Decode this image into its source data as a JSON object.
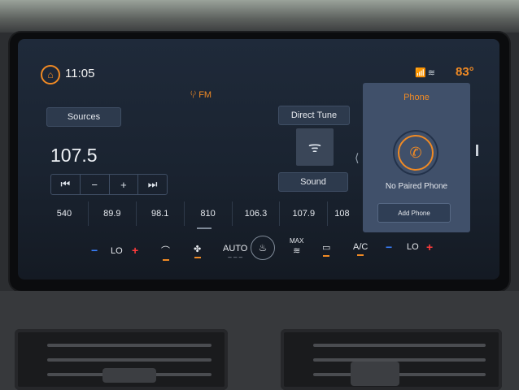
{
  "status": {
    "time": "11:05",
    "temperature": "83°",
    "icons": [
      "phone-signal-icon",
      "wifi-icon"
    ]
  },
  "radio": {
    "band_label": "FM",
    "frequency": "107.5",
    "sources_label": "Sources",
    "direct_tune_label": "Direct Tune",
    "sound_label": "Sound",
    "seek": {
      "prev": "⏮",
      "down": "−",
      "up": "+",
      "next": "⏭"
    },
    "presets": [
      "540",
      "89.9",
      "98.1",
      "810",
      "106.3",
      "107.9",
      "108"
    ]
  },
  "phone": {
    "title": "Phone",
    "status": "No Paired Phone",
    "add_label": "Add Phone"
  },
  "climate": {
    "driver_temp": "LO",
    "passenger_temp": "LO",
    "auto_label": "AUTO",
    "max_label": "MAX",
    "ac_label": "A/C"
  },
  "colors": {
    "accent": "#f08a24",
    "panel": "#40506a",
    "screen": "#1f2a3a"
  }
}
